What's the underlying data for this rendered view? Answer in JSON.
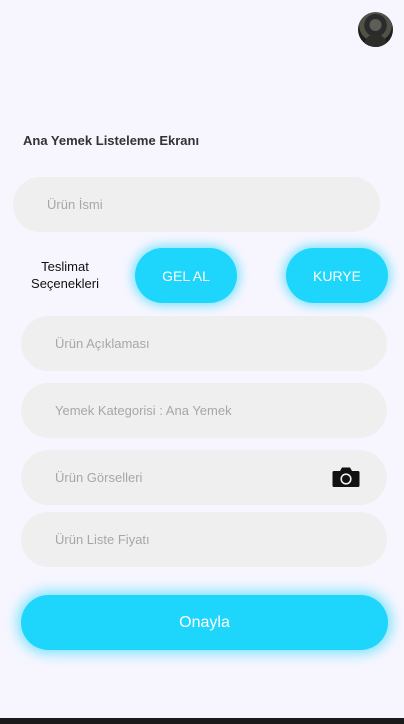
{
  "page": {
    "title": "Ana Yemek Listeleme Ekranı"
  },
  "avatar": {
    "icon": "user-avatar-icon"
  },
  "form": {
    "product_name_placeholder": "Ürün İsmi",
    "delivery_label_line1": "Teslimat",
    "delivery_label_line2": "Seçenekleri",
    "delivery_options": [
      "GEL AL",
      "KURYE"
    ],
    "description_placeholder": "Ürün Açıklaması",
    "category_text": "Yemek Kategorisi : Ana Yemek",
    "images_placeholder": "Ürün Görselleri",
    "images_icon": "camera-icon",
    "price_placeholder": "Ürün Liste Fiyatı",
    "submit_label": "Onayla"
  },
  "colors": {
    "accent": "#1ed6fc",
    "background": "#f7f6ff",
    "field": "#efefef",
    "placeholder": "#a7a7a7"
  }
}
